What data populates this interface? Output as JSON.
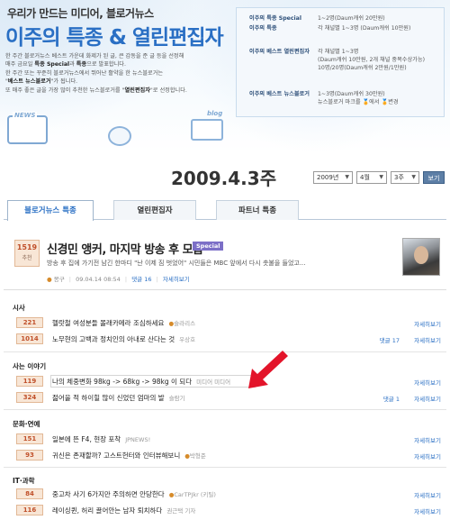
{
  "header": {
    "tagline": "우리가 만드는 미디어, 블로거뉴스",
    "title": "이주의 특종 & 열린편집자",
    "desc_lines": [
      [
        "한 주간 블로거뉴스 베스트 가운데 화제가 된 글, 큰 감동을 준 글 등을 선정해",
        ""
      ],
      [
        "매주 금요일 ",
        "특종 Special",
        "과 ",
        "특종",
        "으로 발표합니다."
      ],
      [
        "한 주간 또는 꾸준히 블로거뉴스에서 뛰어난 활약을 한 뉴스블로거는",
        ""
      ],
      [
        "",
        "베스트 뉴스블로거",
        "가 됩니다."
      ],
      [
        "또 매주 좋은 글을 가장 많이 추천한 뉴스블로거를 ",
        "열린편집자",
        "로 선정합니다."
      ]
    ],
    "deco_newsstand": "NEWS",
    "deco_blog": "blog"
  },
  "info_panel": [
    {
      "k": "이주의 특종 Special",
      "v": [
        "1~2명(Daum캐쉬 20만원)"
      ]
    },
    {
      "k": "이주의 특종",
      "v": [
        "각 채널별 1~3명 (Daum캐쉬 10만원)"
      ]
    },
    {
      "k": "이주의 베스트 열린편집자",
      "v": [
        "각 채널별 1~3명",
        "(Daum캐쉬 10만원, 2개 채널 중복수상가능)",
        "10명/20명(Daum캐쉬 2만원/1만원)"
      ]
    },
    {
      "k": "이주의 베스트 뉴스블로거",
      "v": [
        "1~3명(Daum캐쉬 30만원)",
        "뉴스블로거 마크를 🏅에서 🏅변경"
      ]
    }
  ],
  "date_bar": {
    "date": "2009.4.3주",
    "year": "2009년",
    "month": "4월",
    "week": "3주",
    "view_button": "보기"
  },
  "tabs": [
    "블로거뉴스 특종",
    "열린편집자",
    "파트너 특종"
  ],
  "special": {
    "rank": "1519",
    "rank_label": "추천",
    "title": "신경민 앵커, 마지막 방송 후 모습",
    "badge": "Special",
    "summary": "방송 후 집에 가기전 남긴 한마디 \"난 이제 짐 벗었어\" 시민들은 MBC 앞에서 다시 촛불을 들었고...",
    "author": "몽구",
    "date": "09.04.14 08:54",
    "comments": "댓글 16",
    "detail": "자세히보기"
  },
  "categories": [
    {
      "title": "시사",
      "rows": [
        {
          "num": "221",
          "title": "헬랏철 여성분들 몰래카메라 조심하세요",
          "author": "슬라리스",
          "comments": "",
          "detail": "자세히보기"
        },
        {
          "num": "1014",
          "title": "노무현의 고백과 정치인의 아내로 산다는 것",
          "author": "우상호",
          "comments": "댓글 17",
          "detail": "자세히보기"
        }
      ]
    },
    {
      "title": "사는 이야기",
      "rows": [
        {
          "num": "119",
          "title": "나의 체중변화 98kg -> 68kg -> 98kg 이 되다",
          "author": "미디어 미디어",
          "comments": "",
          "detail": "자세히보기"
        },
        {
          "num": "324",
          "title": "젊어을 적 하이힐 많이 신었던 엄마의 발",
          "author": "슬람기",
          "comments": "댓글 1",
          "detail": "자세히보기"
        }
      ]
    },
    {
      "title": "문화·연예",
      "rows": [
        {
          "num": "151",
          "title": "일본에 뜬 F4, 현장 포착",
          "author": "JPNEWS!",
          "comments": "",
          "detail": "자세히보기"
        },
        {
          "num": "93",
          "title": "귀신은 존재할까? 고스트헌터와 인터뷰해보니",
          "author": "박형준",
          "comments": "",
          "detail": "자세히보기"
        }
      ]
    },
    {
      "title": "IT·과학",
      "rows": [
        {
          "num": "84",
          "title": "중고차 사기 6가지만 주의하면 안당한다",
          "author": "CarTPJkr (키틸)",
          "comments": "",
          "detail": "자세히보기"
        },
        {
          "num": "116",
          "title": "레이싱퀸, 허리 끌어안는 남자 퇴치하다",
          "author": "권근택 기자",
          "comments": "",
          "detail": "자세히보기"
        }
      ]
    }
  ],
  "colors": {
    "accent": "#2a6fc4",
    "rank_bg": "#f8e6d6",
    "rank_text": "#c0502a",
    "arrow": "#e3142a"
  }
}
